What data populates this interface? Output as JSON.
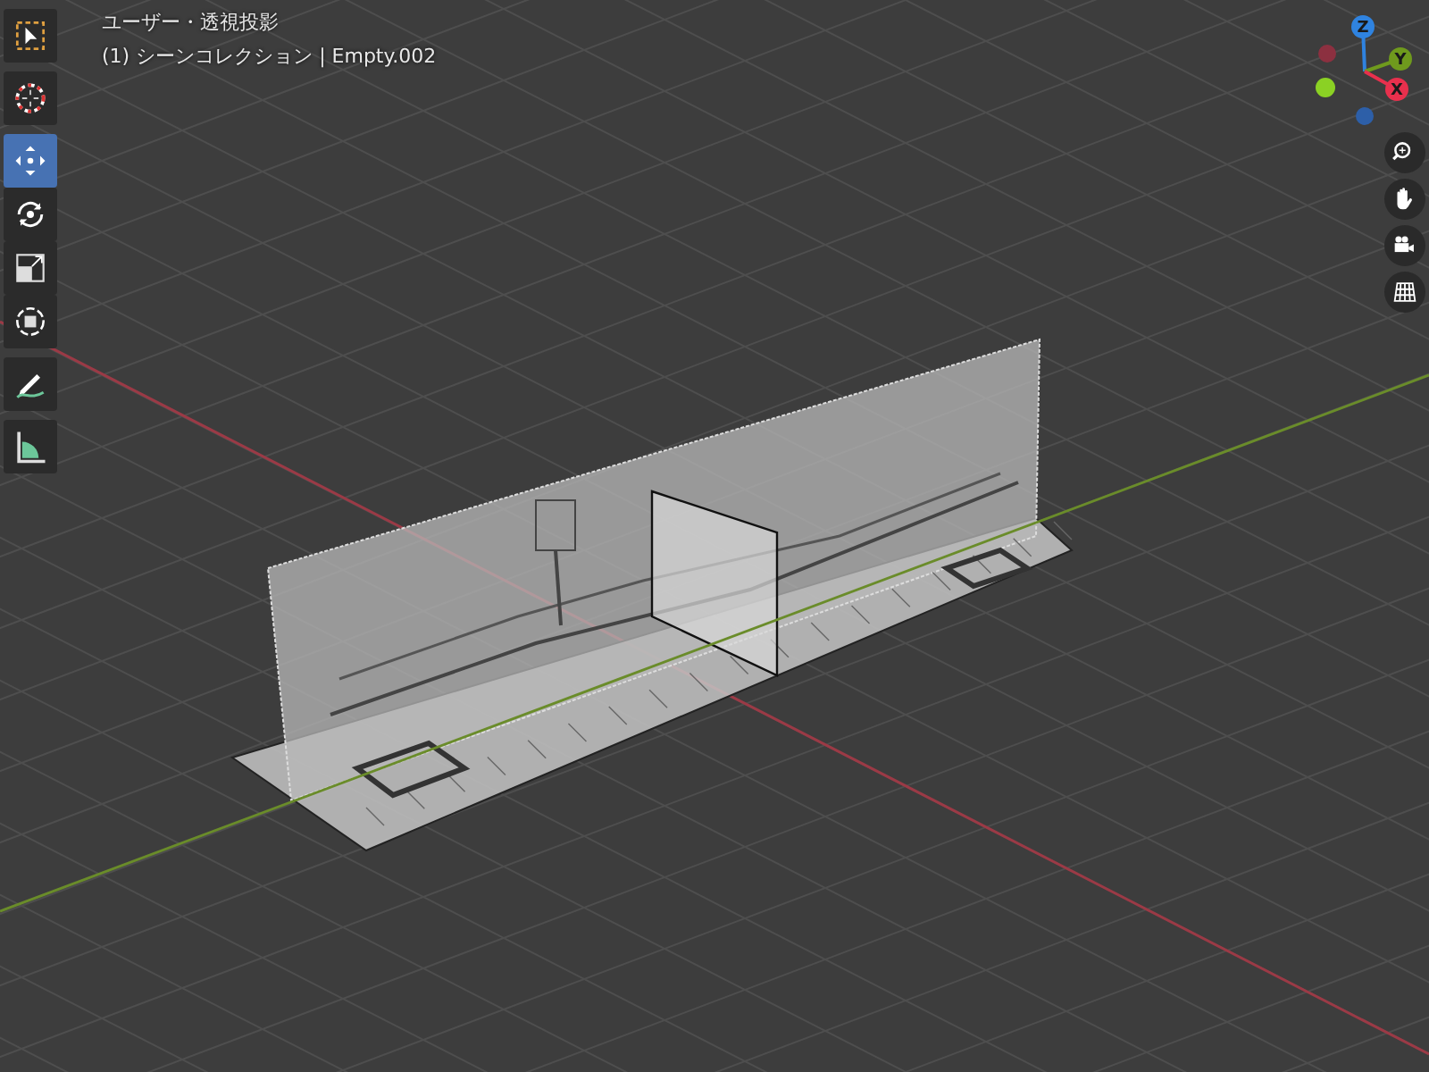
{
  "header": {
    "view_name": "ユーザー・透視投影",
    "object_info": "(1) シーンコレクション | Empty.002"
  },
  "toolbar": {
    "tools": [
      {
        "kind": "select",
        "selected": false
      },
      {
        "kind": "cursor",
        "selected": false
      },
      {
        "kind": "move",
        "selected": true
      },
      {
        "kind": "rotate",
        "selected": false
      },
      {
        "kind": "scale",
        "selected": false
      },
      {
        "kind": "transform",
        "selected": false
      },
      {
        "kind": "annotate",
        "selected": false
      },
      {
        "kind": "measure",
        "selected": false
      }
    ]
  },
  "gizmo": {
    "axes": [
      {
        "label": "Z",
        "color": "#2f83e0"
      },
      {
        "label": "Y",
        "color": "#6f9a1d"
      },
      {
        "label": "X",
        "color": "#e8304d"
      }
    ]
  },
  "navigation": {
    "buttons": [
      {
        "kind": "zoom"
      },
      {
        "kind": "pan"
      },
      {
        "kind": "camera"
      },
      {
        "kind": "ortho"
      }
    ]
  }
}
